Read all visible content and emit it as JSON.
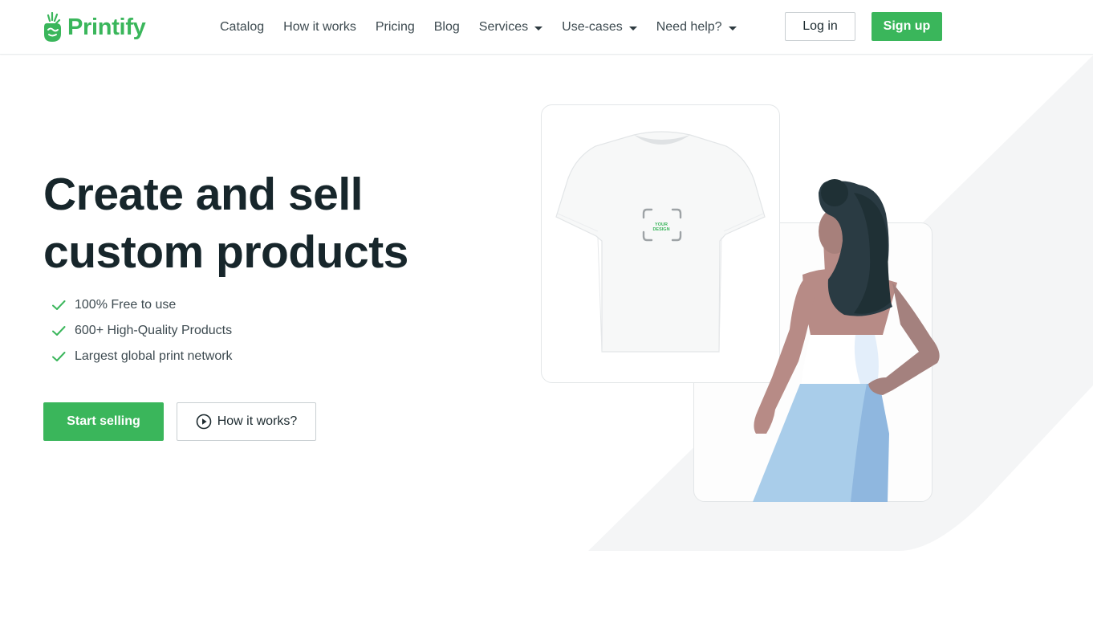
{
  "brand": {
    "name": "Printify",
    "color": "#3ab65b"
  },
  "nav": {
    "items": [
      {
        "label": "Catalog",
        "dropdown": false
      },
      {
        "label": "How it works",
        "dropdown": false
      },
      {
        "label": "Pricing",
        "dropdown": false
      },
      {
        "label": "Blog",
        "dropdown": false
      },
      {
        "label": "Services",
        "dropdown": true
      },
      {
        "label": "Use-cases",
        "dropdown": true
      },
      {
        "label": "Need help?",
        "dropdown": true
      }
    ]
  },
  "auth": {
    "login_label": "Log in",
    "signup_label": "Sign up"
  },
  "hero": {
    "title_line1": "Create and sell",
    "title_line2": "custom products",
    "features": [
      "100% Free to use",
      "600+ High-Quality Products",
      "Largest global print network"
    ],
    "cta_primary": "Start selling",
    "cta_secondary": "How it works?",
    "shirt_placeholder_line1": "YOUR",
    "shirt_placeholder_line2": "DESIGN"
  },
  "icons": {
    "logo": "printify-logo-icon",
    "check": "check-icon",
    "play": "play-circle-icon",
    "dropdown": "caret-down-icon"
  },
  "colors": {
    "accent": "#3ab65b",
    "title": "#17262b",
    "text": "#3d4a50",
    "hero_shape": "#f4f5f6"
  }
}
